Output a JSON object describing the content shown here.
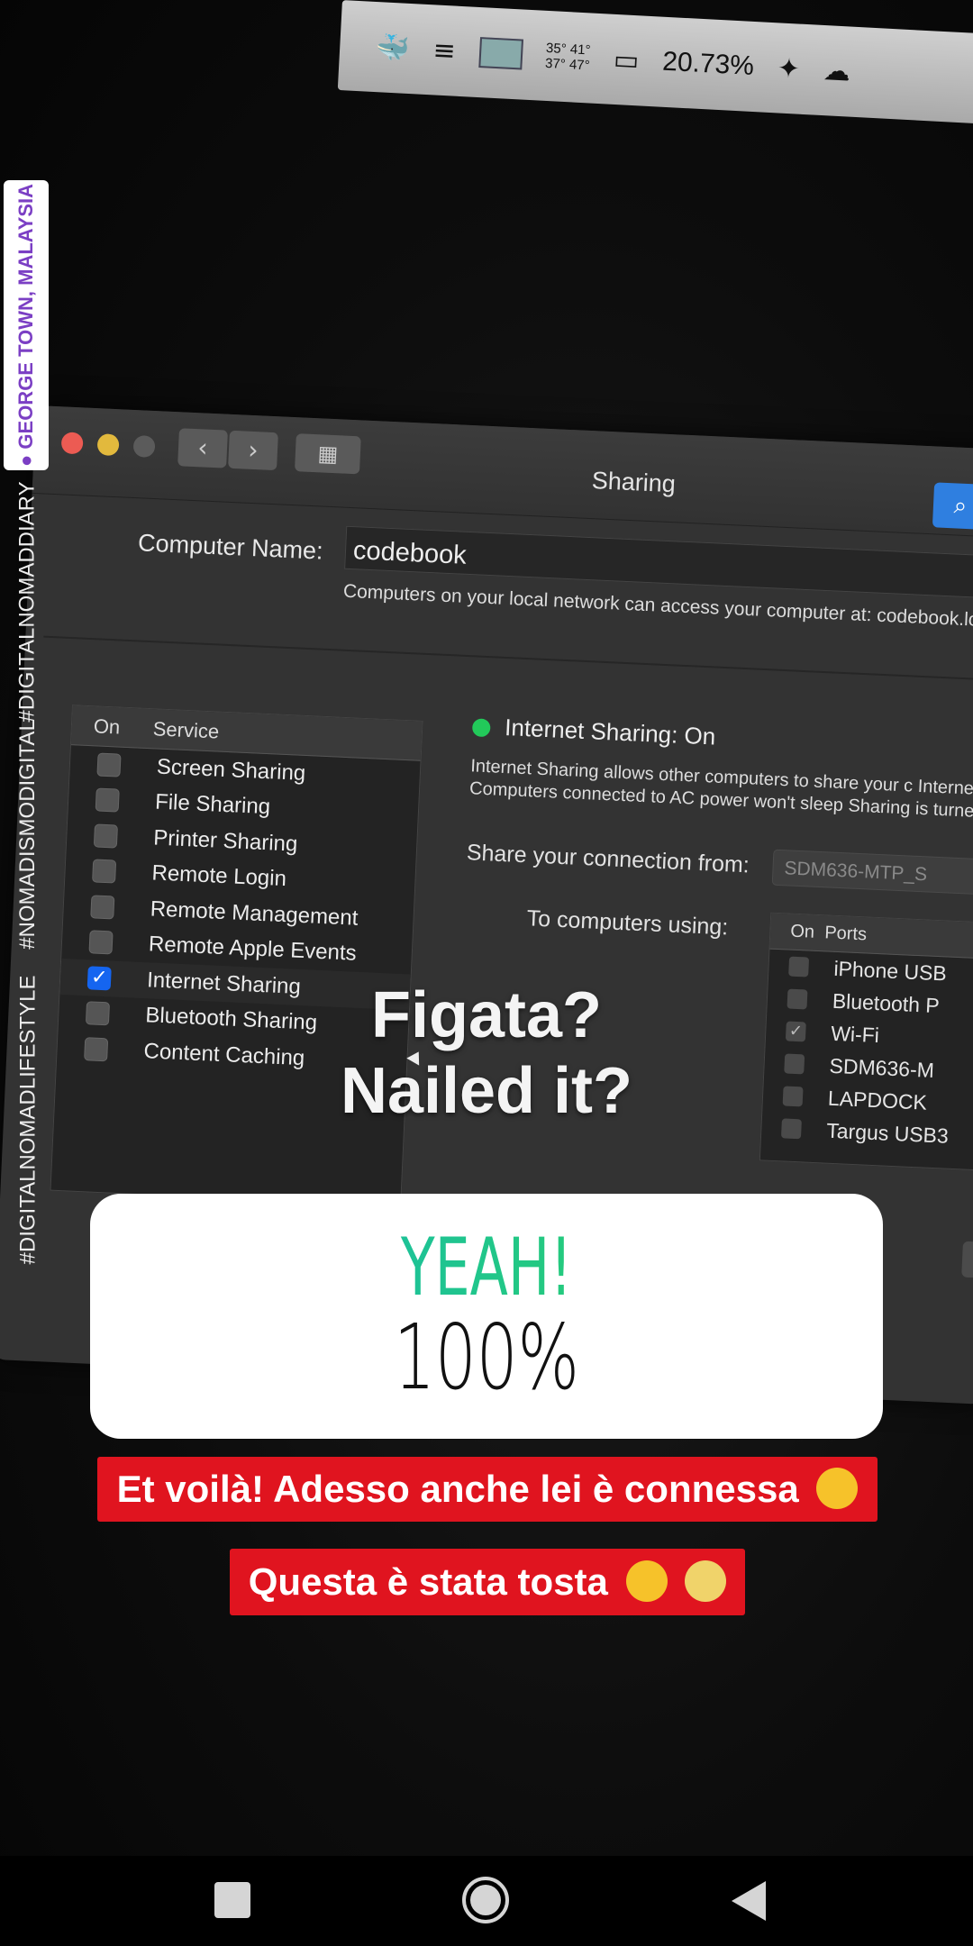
{
  "menubar": {
    "temps_top": "35° 41°",
    "temps_bottom": "37° 47°",
    "battery": "20.73%"
  },
  "window": {
    "title": "Sharing",
    "computer_name_label": "Computer Name:",
    "computer_name_value": "codebook",
    "computer_name_note": "Computers on your local network can access your computer at: codebook.local",
    "services_header": {
      "on": "On",
      "service": "Service"
    },
    "services": [
      {
        "label": "Screen Sharing",
        "checked": false
      },
      {
        "label": "File Sharing",
        "checked": false
      },
      {
        "label": "Printer Sharing",
        "checked": false
      },
      {
        "label": "Remote Login",
        "checked": false
      },
      {
        "label": "Remote Management",
        "checked": false
      },
      {
        "label": "Remote Apple Events",
        "checked": false
      },
      {
        "label": "Internet Sharing",
        "checked": true
      },
      {
        "label": "Bluetooth Sharing",
        "checked": false
      },
      {
        "label": "Content Caching",
        "checked": false
      }
    ],
    "status": "Internet Sharing: On",
    "description": "Internet Sharing allows other computers to share your c Internet. Computers connected to AC power won't sleep Sharing is turned on.",
    "share_from_label": "Share your connection from:",
    "share_from_value": "SDM636-MTP_S",
    "to_computers_label": "To computers using:",
    "ports_header": {
      "on": "On",
      "ports": "Ports"
    },
    "ports": [
      {
        "label": "iPhone USB",
        "checked": false
      },
      {
        "label": "Bluetooth P",
        "checked": false
      },
      {
        "label": "Wi-Fi",
        "checked": true
      },
      {
        "label": "SDM636-M",
        "checked": false
      },
      {
        "label": "LAPDOCK",
        "checked": false
      },
      {
        "label": "Targus USB3",
        "checked": false
      }
    ]
  },
  "overlay": {
    "question_line1": "Figata?",
    "question_line2": "Nailed it?",
    "poll_answer": "YEAH!",
    "poll_percent": "100%",
    "caption1": "Et voilà! Adesso anche lei è connessa",
    "caption2": "Questa è stata tosta",
    "location_tag": "GEORGE TOWN, MALAYSIA",
    "hashtags": [
      "#DIGITALNOMADDIARY",
      "#NOMADISMODIGITAL",
      "#DIGITALNOMADLIFESTYLE"
    ]
  },
  "colors": {
    "caption_bg": "#e0141f",
    "poll_gradient_start": "#13b8b8",
    "poll_gradient_end": "#2fd45c",
    "status_green": "#22c95a",
    "checkbox_blue": "#1565f0",
    "location_text": "#7b3fc4"
  }
}
